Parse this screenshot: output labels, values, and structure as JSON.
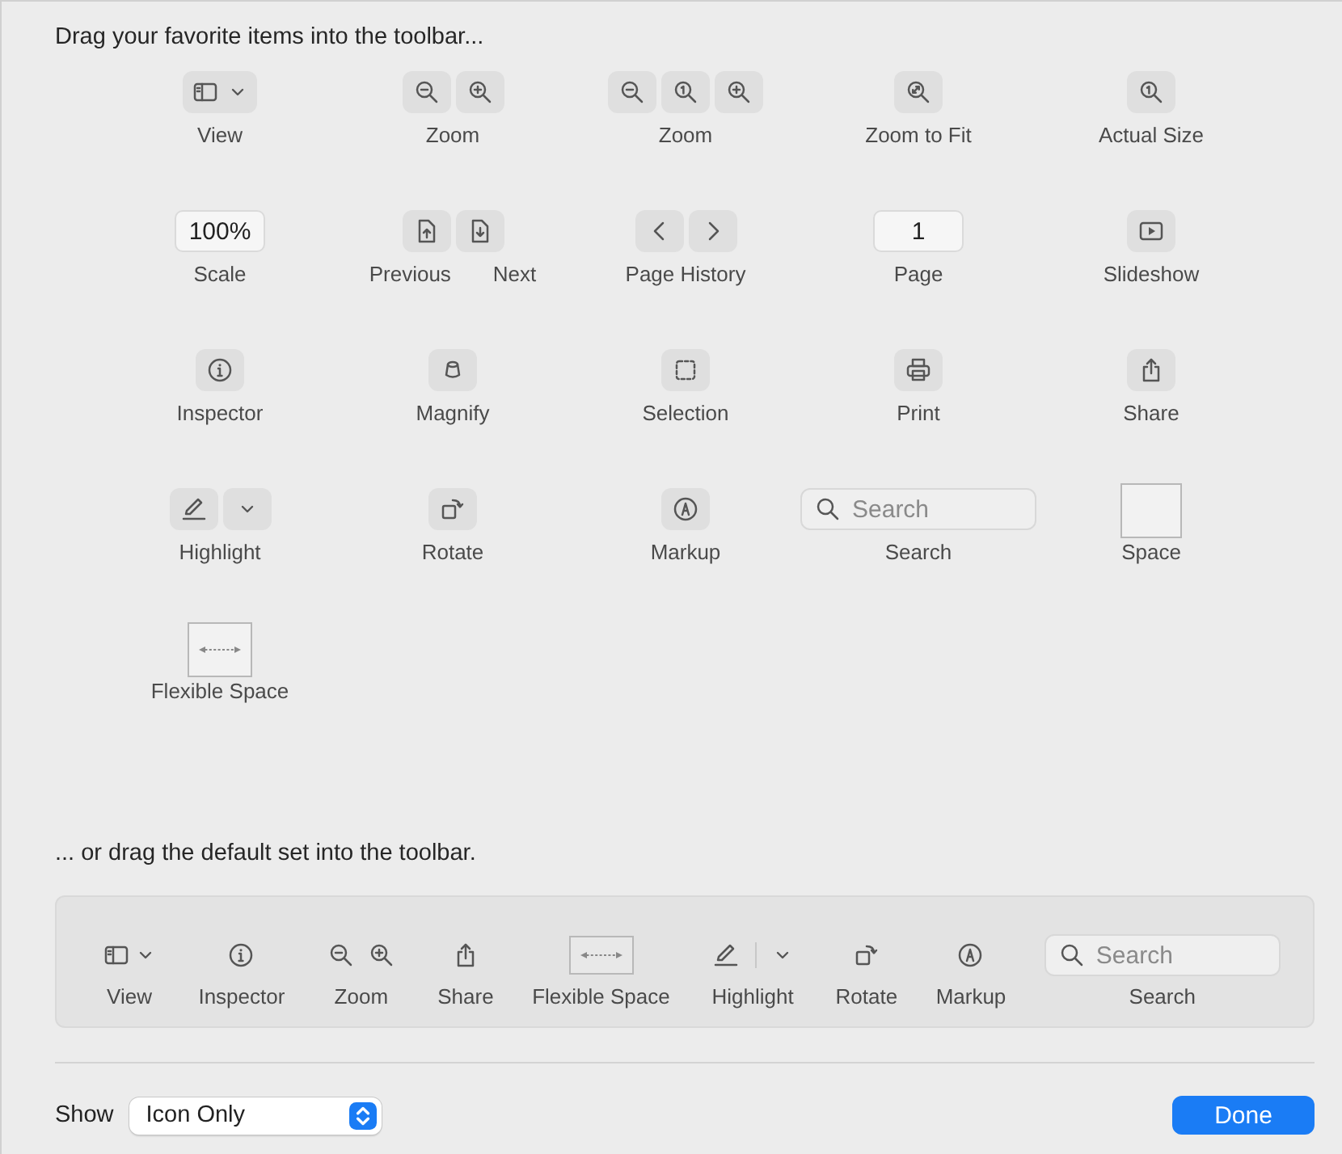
{
  "header": "Drag your favorite items into the toolbar...",
  "palette": [
    {
      "kind": "view",
      "label": "View"
    },
    {
      "kind": "zoom2",
      "label": "Zoom"
    },
    {
      "kind": "zoom3",
      "label": "Zoom"
    },
    {
      "kind": "zoom-fit",
      "label": "Zoom to Fit"
    },
    {
      "kind": "actual-size",
      "label": "Actual Size"
    },
    {
      "kind": "text-field",
      "value": "100%",
      "label": "Scale"
    },
    {
      "kind": "prev-next",
      "labels": [
        "Previous",
        "Next"
      ]
    },
    {
      "kind": "page-history",
      "label": "Page History"
    },
    {
      "kind": "text-field",
      "value": "1",
      "label": "Page"
    },
    {
      "kind": "slideshow",
      "label": "Slideshow"
    },
    {
      "kind": "inspector",
      "label": "Inspector"
    },
    {
      "kind": "magnify",
      "label": "Magnify"
    },
    {
      "kind": "selection",
      "label": "Selection"
    },
    {
      "kind": "print",
      "label": "Print"
    },
    {
      "kind": "share",
      "label": "Share"
    },
    {
      "kind": "highlight",
      "label": "Highlight"
    },
    {
      "kind": "rotate",
      "label": "Rotate"
    },
    {
      "kind": "markup",
      "label": "Markup"
    },
    {
      "kind": "search",
      "placeholder": "Search",
      "label": "Search"
    },
    {
      "kind": "space",
      "label": "Space"
    },
    {
      "kind": "flexible-space",
      "label": "Flexible Space"
    }
  ],
  "default_header": "... or drag the default set into the toolbar.",
  "default_set": [
    {
      "kind": "view",
      "label": "View"
    },
    {
      "kind": "inspector",
      "label": "Inspector"
    },
    {
      "kind": "zoom2",
      "label": "Zoom"
    },
    {
      "kind": "share",
      "label": "Share"
    },
    {
      "kind": "flexible-space",
      "label": "Flexible Space"
    },
    {
      "kind": "highlight",
      "label": "Highlight"
    },
    {
      "kind": "rotate",
      "label": "Rotate"
    },
    {
      "kind": "markup",
      "label": "Markup"
    },
    {
      "kind": "search",
      "placeholder": "Search",
      "label": "Search"
    }
  ],
  "show": {
    "label": "Show",
    "value": "Icon Only"
  },
  "done_button": "Done"
}
